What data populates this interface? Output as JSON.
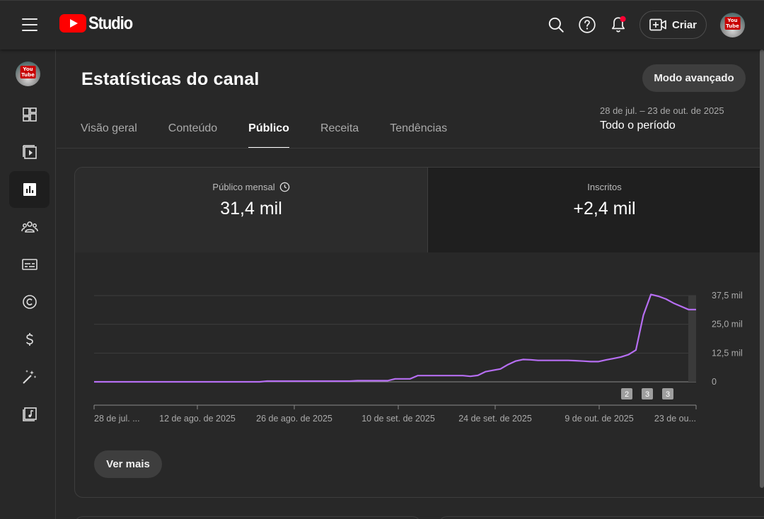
{
  "app": {
    "logo_text": "Studio"
  },
  "header": {
    "create_label": "Criar"
  },
  "page": {
    "title": "Estatísticas do canal",
    "advanced_button": "Modo avançado",
    "tabs": [
      {
        "label": "Visão geral",
        "active": false
      },
      {
        "label": "Conteúdo",
        "active": false
      },
      {
        "label": "Público",
        "active": true
      },
      {
        "label": "Receita",
        "active": false
      },
      {
        "label": "Tendências",
        "active": false
      }
    ],
    "date_range": "28 de jul. – 23 de out. de 2025",
    "date_period": "Todo o período"
  },
  "sidebar": {
    "items": [
      {
        "icon": "dashboard-icon",
        "active": false
      },
      {
        "icon": "content-icon",
        "active": false
      },
      {
        "icon": "analytics-icon",
        "active": true
      },
      {
        "icon": "community-icon",
        "active": false
      },
      {
        "icon": "subtitles-icon",
        "active": false
      },
      {
        "icon": "copyright-icon",
        "active": false
      },
      {
        "icon": "earn-icon",
        "active": false
      },
      {
        "icon": "customization-icon",
        "active": false
      },
      {
        "icon": "audio-library-icon",
        "active": false
      }
    ]
  },
  "metrics": [
    {
      "label": "Público mensal",
      "value": "31,4 mil",
      "selected": true
    },
    {
      "label": "Inscritos",
      "value": "+2,4 mil",
      "selected": false
    }
  ],
  "chart_data": {
    "type": "line",
    "series": [
      {
        "color": "#b66ef2",
        "values": [
          0,
          0,
          0,
          0,
          0,
          0,
          0,
          0,
          0,
          0,
          0,
          0,
          0,
          0,
          0,
          0,
          0,
          0,
          0,
          0,
          0,
          0,
          0,
          0.3,
          0.3,
          0.3,
          0.3,
          0.3,
          0.3,
          0.3,
          0.3,
          0.3,
          0.3,
          0.3,
          0.3,
          0.5,
          0.5,
          0.5,
          0.5,
          0.5,
          1.3,
          1.3,
          1.3,
          2.7,
          2.7,
          2.7,
          2.7,
          2.7,
          2.7,
          2.7,
          2.4,
          2.8,
          4.4,
          5.0,
          5.6,
          7.5,
          9.0,
          9.7,
          9.6,
          9.3,
          9.3,
          9.3,
          9.3,
          9.3,
          9.2,
          9.0,
          8.8,
          8.8,
          9.5,
          10.1,
          10.8,
          11.8,
          13.8,
          29.0,
          38.0,
          37.2,
          36.0,
          34.2,
          32.8,
          31.4,
          31.4
        ]
      }
    ],
    "x_tick_labels": [
      "28 de jul. ...",
      "12 de ago. de 2025",
      "26 de ago. de 2025",
      "10 de set. de 2025",
      "24 de set. de 2025",
      "9 de out. de 2025",
      "23 de ou..."
    ],
    "y_tick_labels": [
      "0",
      "12,5 mil",
      "25,0 mil",
      "37,5 mil"
    ],
    "y_ticks": [
      0,
      12.5,
      25,
      37.5
    ],
    "ylim": [
      0,
      37.5
    ],
    "grid": true,
    "markers": [
      "2",
      "3",
      "3"
    ]
  },
  "chart_actions": {
    "see_more": "Ver mais"
  }
}
